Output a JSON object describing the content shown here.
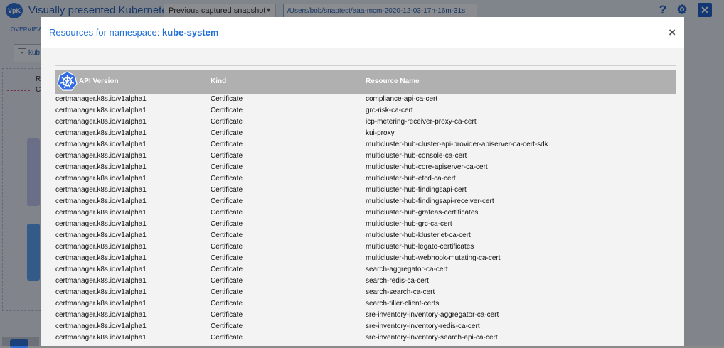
{
  "app": {
    "logo_text": "VpK",
    "title": "Visually presented Kubernetes",
    "snapshot_select": "Previous captured snapshot",
    "snapshot_path": "/Users/bob/snaptest/aaa-mcm-2020-12-03-17h-16m-31s",
    "overview_tab": "OVERVIEW",
    "filter_text": "kub",
    "legend": [
      "R",
      "C"
    ],
    "icons": {
      "help": "question-mark-icon",
      "settings": "gear-icon",
      "close": "close-icon"
    }
  },
  "modal": {
    "title_prefix": "Resources for namespace:",
    "namespace": "kube-system",
    "close_glyph": "×",
    "columns": [
      "API Version",
      "Kind",
      "Resource Name"
    ],
    "rows": [
      [
        "certmanager.k8s.io/v1alpha1",
        "Certificate",
        "compliance-api-ca-cert"
      ],
      [
        "certmanager.k8s.io/v1alpha1",
        "Certificate",
        "grc-risk-ca-cert"
      ],
      [
        "certmanager.k8s.io/v1alpha1",
        "Certificate",
        "icp-metering-receiver-proxy-ca-cert"
      ],
      [
        "certmanager.k8s.io/v1alpha1",
        "Certificate",
        "kui-proxy"
      ],
      [
        "certmanager.k8s.io/v1alpha1",
        "Certificate",
        "multicluster-hub-cluster-api-provider-apiserver-ca-cert-sdk"
      ],
      [
        "certmanager.k8s.io/v1alpha1",
        "Certificate",
        "multicluster-hub-console-ca-cert"
      ],
      [
        "certmanager.k8s.io/v1alpha1",
        "Certificate",
        "multicluster-hub-core-apiserver-ca-cert"
      ],
      [
        "certmanager.k8s.io/v1alpha1",
        "Certificate",
        "multicluster-hub-etcd-ca-cert"
      ],
      [
        "certmanager.k8s.io/v1alpha1",
        "Certificate",
        "multicluster-hub-findingsapi-cert"
      ],
      [
        "certmanager.k8s.io/v1alpha1",
        "Certificate",
        "multicluster-hub-findingsapi-receiver-cert"
      ],
      [
        "certmanager.k8s.io/v1alpha1",
        "Certificate",
        "multicluster-hub-grafeas-certificates"
      ],
      [
        "certmanager.k8s.io/v1alpha1",
        "Certificate",
        "multicluster-hub-grc-ca-cert"
      ],
      [
        "certmanager.k8s.io/v1alpha1",
        "Certificate",
        "multicluster-hub-klusterlet-ca-cert"
      ],
      [
        "certmanager.k8s.io/v1alpha1",
        "Certificate",
        "multicluster-hub-legato-certificates"
      ],
      [
        "certmanager.k8s.io/v1alpha1",
        "Certificate",
        "multicluster-hub-webhook-mutating-ca-cert"
      ],
      [
        "certmanager.k8s.io/v1alpha1",
        "Certificate",
        "search-aggregator-ca-cert"
      ],
      [
        "certmanager.k8s.io/v1alpha1",
        "Certificate",
        "search-redis-ca-cert"
      ],
      [
        "certmanager.k8s.io/v1alpha1",
        "Certificate",
        "search-search-ca-cert"
      ],
      [
        "certmanager.k8s.io/v1alpha1",
        "Certificate",
        "search-tiller-client-certs"
      ],
      [
        "certmanager.k8s.io/v1alpha1",
        "Certificate",
        "sre-inventory-inventory-aggregator-ca-cert"
      ],
      [
        "certmanager.k8s.io/v1alpha1",
        "Certificate",
        "sre-inventory-inventory-redis-ca-cert"
      ],
      [
        "certmanager.k8s.io/v1alpha1",
        "Certificate",
        "sre-inventory-inventory-search-api-ca-cert"
      ]
    ]
  },
  "colors": {
    "accent": "#1f6fd6",
    "header_gray": "#b0b0b0",
    "k8s_blue": "#326ce5"
  }
}
